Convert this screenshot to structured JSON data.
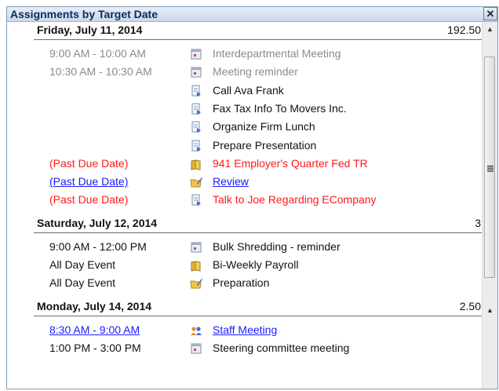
{
  "window": {
    "title": "Assignments by Target Date",
    "close_glyph": "✕"
  },
  "groups": [
    {
      "date": "Friday, July 11, 2014",
      "total": "192.50",
      "items": [
        {
          "time": "9:00 AM - 10:00 AM",
          "subject": "Interdepartmental Meeting",
          "icon": "calendar-icon",
          "style": "gray"
        },
        {
          "time": "10:30 AM - 10:30 AM",
          "subject": "Meeting reminder",
          "icon": "calendar-icon",
          "style": "gray"
        },
        {
          "time": "",
          "subject": "Call Ava Frank",
          "icon": "task-icon",
          "style": "black"
        },
        {
          "time": "",
          "subject": "Fax Tax Info To Movers Inc.",
          "icon": "task-icon",
          "style": "black"
        },
        {
          "time": "",
          "subject": "Organize Firm Lunch",
          "icon": "task-icon",
          "style": "black"
        },
        {
          "time": "",
          "subject": "Prepare Presentation",
          "icon": "task-icon",
          "style": "black"
        },
        {
          "time": "(Past Due Date)",
          "subject": "941 Employer's Quarter Fed TR",
          "icon": "project-icon",
          "style": "red"
        },
        {
          "time": "(Past Due Date)",
          "subject": "Review",
          "icon": "folder-pencil-icon",
          "style": "blue"
        },
        {
          "time": "(Past Due Date)",
          "subject": "Talk to Joe Regarding ECompany",
          "icon": "task-icon",
          "style": "red"
        }
      ]
    },
    {
      "date": "Saturday, July 12, 2014",
      "total": "3",
      "items": [
        {
          "time": "9:00 AM - 12:00 PM",
          "subject": "Bulk Shredding - reminder",
          "icon": "calendar-icon",
          "style": "black"
        },
        {
          "time": "All Day Event",
          "subject": "Bi-Weekly Payroll",
          "icon": "project-icon",
          "style": "black"
        },
        {
          "time": "All Day Event",
          "subject": "Preparation",
          "icon": "folder-pencil-icon",
          "style": "black"
        }
      ]
    },
    {
      "date": "Monday, July 14, 2014",
      "total": "2.50",
      "items": [
        {
          "time": "8:30 AM - 9:00 AM",
          "subject": "Staff Meeting",
          "icon": "people-icon",
          "style": "blue"
        },
        {
          "time": "1:00 PM - 3:00 PM",
          "subject": "Steering committee meeting",
          "icon": "calendar-icon",
          "style": "black"
        }
      ]
    }
  ],
  "scrollbar": {
    "up_glyph": "▲",
    "down_glyph": "▲"
  },
  "colors": {
    "past_due": "#ff1a1a",
    "link": "#1a1aff",
    "completed": "#8a8a8a",
    "header_text": "#0d2a5c"
  }
}
